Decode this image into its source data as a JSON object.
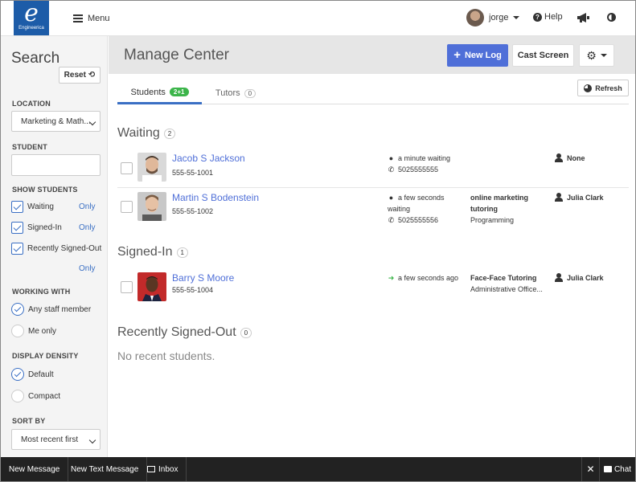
{
  "brand": {
    "logo_letter": "e",
    "name": "Engineerica"
  },
  "topbar": {
    "menu_label": "Menu",
    "user_name": "jorge",
    "help_label": "Help"
  },
  "sidebar": {
    "title": "Search",
    "reset_label": "Reset",
    "location_label": "LOCATION",
    "location_value": "Marketing & Math...",
    "student_label": "STUDENT",
    "student_value": "",
    "show_students_label": "SHOW STUDENTS",
    "show_options": [
      {
        "label": "Waiting",
        "checked": true,
        "only": "Only"
      },
      {
        "label": "Signed-In",
        "checked": true,
        "only": "Only"
      },
      {
        "label": "Recently Signed-Out",
        "checked": true,
        "only": "Only"
      }
    ],
    "working_with_label": "WORKING WITH",
    "working_with_options": [
      {
        "label": "Any staff member",
        "selected": true
      },
      {
        "label": "Me only",
        "selected": false
      }
    ],
    "density_label": "DISPLAY DENSITY",
    "density_options": [
      {
        "label": "Default",
        "selected": true
      },
      {
        "label": "Compact",
        "selected": false
      }
    ],
    "sort_label": "SORT BY",
    "sort_value": "Most recent first"
  },
  "main": {
    "title": "Manage Center",
    "new_log_label": "New Log",
    "cast_screen_label": "Cast Screen",
    "refresh_label": "Refresh",
    "tabs": [
      {
        "label": "Students",
        "badge": "2+1",
        "active": true
      },
      {
        "label": "Tutors",
        "badge": "0",
        "active": false
      }
    ],
    "waiting": {
      "title": "Waiting",
      "count": "2",
      "rows": [
        {
          "name": "Jacob S Jackson",
          "id": "555-55-1001",
          "time": "a minute waiting",
          "phone": "5025555555",
          "course": "",
          "course_sub": "",
          "staff": "None"
        },
        {
          "name": "Martin S Bodenstein",
          "id": "555-55-1002",
          "time": "a few seconds waiting",
          "phone": "5025555556",
          "course": "online marketing tutoring",
          "course_sub": "Programming",
          "staff": "Julia Clark"
        }
      ]
    },
    "signed_in": {
      "title": "Signed-In",
      "count": "1",
      "rows": [
        {
          "name": "Barry S Moore",
          "id": "555-55-1004",
          "time": "a few seconds ago",
          "course": "Face-Face Tutoring",
          "course_sub": "Administrative Office...",
          "staff": "Julia Clark"
        }
      ]
    },
    "signed_out": {
      "title": "Recently Signed-Out",
      "count": "0",
      "empty": "No recent students."
    }
  },
  "bottombar": {
    "new_message": "New Message",
    "new_text_message": "New Text Message",
    "inbox": "Inbox",
    "close": "✕",
    "chat": "Chat"
  },
  "colors": {
    "primary": "#4f6fd8",
    "brand": "#1d5ca8",
    "success": "#3cb54a",
    "link": "#3a6fc4"
  }
}
